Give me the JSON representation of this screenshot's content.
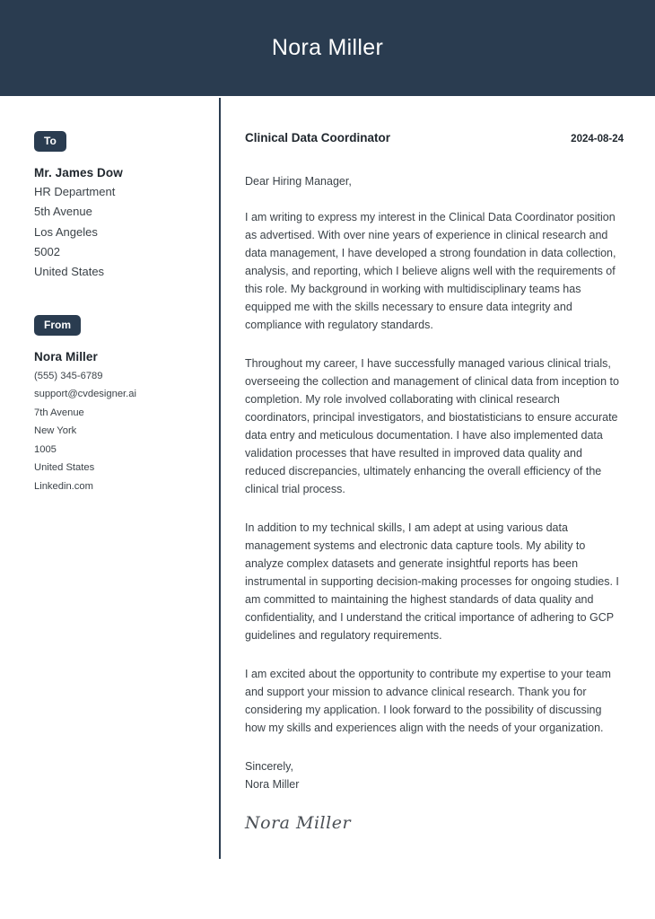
{
  "header": {
    "name": "Nora Miller"
  },
  "colors": {
    "header_bg": "#2a3c50",
    "badge_bg": "#2a3c50",
    "divider": "#2a3c50",
    "body_text": "#3b4248"
  },
  "sidebar": {
    "to": {
      "badge_label": "To",
      "name": "Mr. James Dow",
      "lines": [
        "HR Department",
        "5th Avenue",
        "Los Angeles",
        "5002",
        "United States"
      ]
    },
    "from": {
      "badge_label": "From",
      "name": "Nora Miller",
      "lines": [
        "(555) 345-6789",
        "support@cvdesigner.ai",
        "7th Avenue",
        "New York",
        "1005",
        "United States",
        "Linkedin.com"
      ]
    }
  },
  "letter": {
    "job_title": "Clinical Data Coordinator",
    "date": "2024-08-24",
    "salutation": "Dear Hiring Manager,",
    "paragraphs": [
      "I am writing to express my interest in the Clinical Data Coordinator position as advertised. With over nine years of experience in clinical research and data management, I have developed a strong foundation in data collection, analysis, and reporting, which I believe aligns well with the requirements of this role. My background in working with multidisciplinary teams has equipped me with the skills necessary to ensure data integrity and compliance with regulatory standards.",
      "Throughout my career, I have successfully managed various clinical trials, overseeing the collection and management of clinical data from inception to completion. My role involved collaborating with clinical research coordinators, principal investigators, and biostatisticians to ensure accurate data entry and meticulous documentation. I have also implemented data validation processes that have resulted in improved data quality and reduced discrepancies, ultimately enhancing the overall efficiency of the clinical trial process.",
      "In addition to my technical skills, I am adept at using various data management systems and electronic data capture tools. My ability to analyze complex datasets and generate insightful reports has been instrumental in supporting decision-making processes for ongoing studies. I am committed to maintaining the highest standards of data quality and confidentiality, and I understand the critical importance of adhering to GCP guidelines and regulatory requirements.",
      "I am excited about the opportunity to contribute my expertise to your team and support your mission to advance clinical research. Thank you for considering my application. I look forward to the possibility of discussing how my skills and experiences align with the needs of your organization."
    ],
    "closing_word": "Sincerely,",
    "closing_name": "Nora Miller",
    "signature": "Nora Miller"
  }
}
